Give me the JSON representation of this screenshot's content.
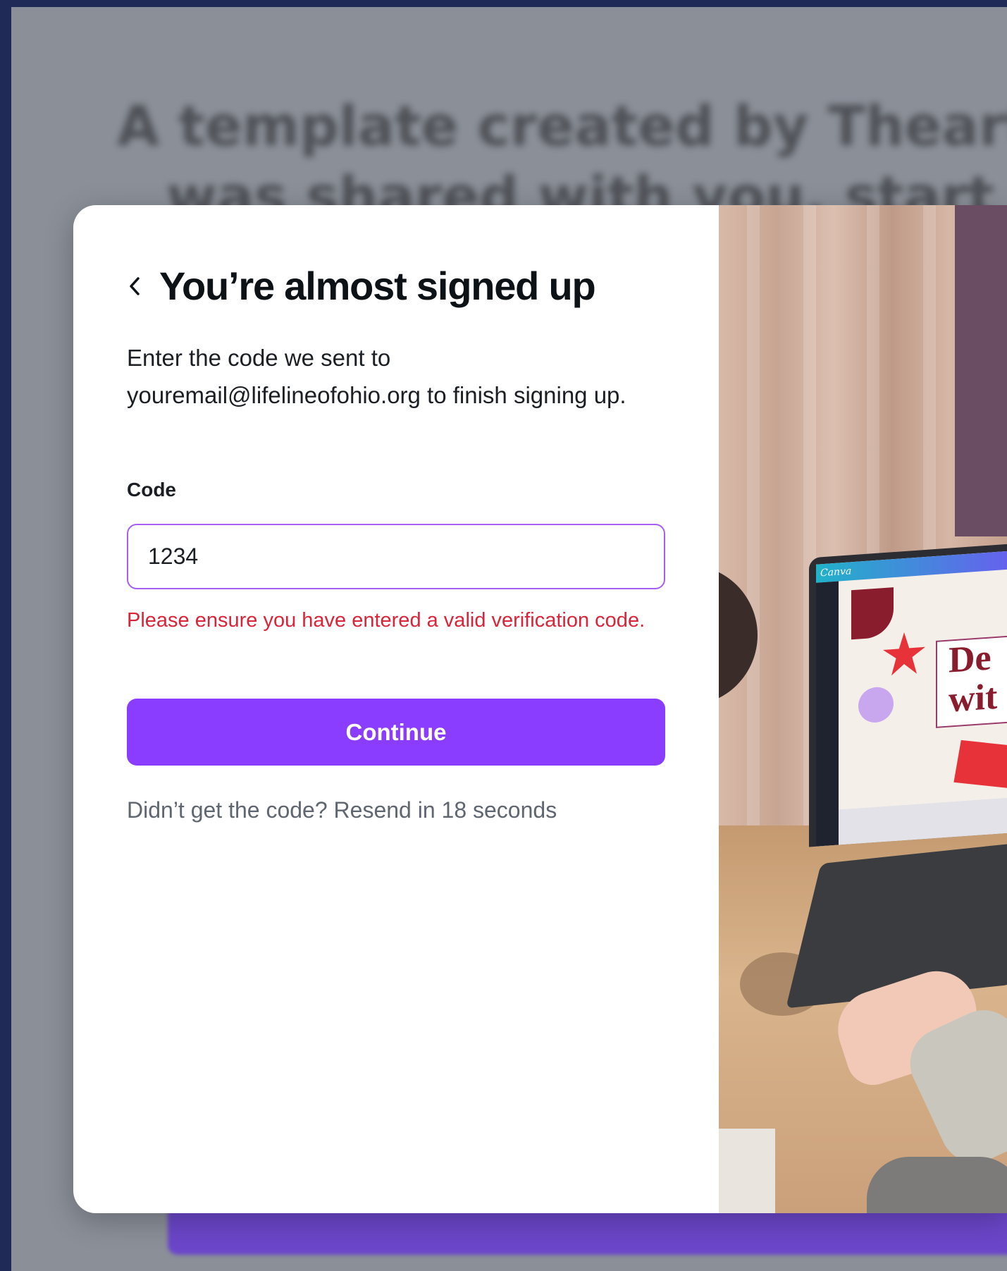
{
  "background": {
    "heading_line1": "A template created by Theartofe",
    "heading_line2": "was shared with you, start desi"
  },
  "modal": {
    "title": "You’re almost signed up",
    "instructions": "Enter the code we sent to youremail@lifelineofohio.org to finish signing up.",
    "code_label": "Code",
    "code_value": "1234",
    "error_message": "Please ensure you have entered a valid verification code.",
    "continue_label": "Continue",
    "resend_text": "Didn’t get the code? Resend in 18 seconds"
  },
  "illustration": {
    "app_logo": "Canva",
    "slide_text": "De wit"
  },
  "colors": {
    "accent": "#8b3dff",
    "input_border": "#a65ff0",
    "error": "#d9243a",
    "frame": "#1f2a57"
  },
  "icons": {
    "back": "chevron-left-icon"
  }
}
